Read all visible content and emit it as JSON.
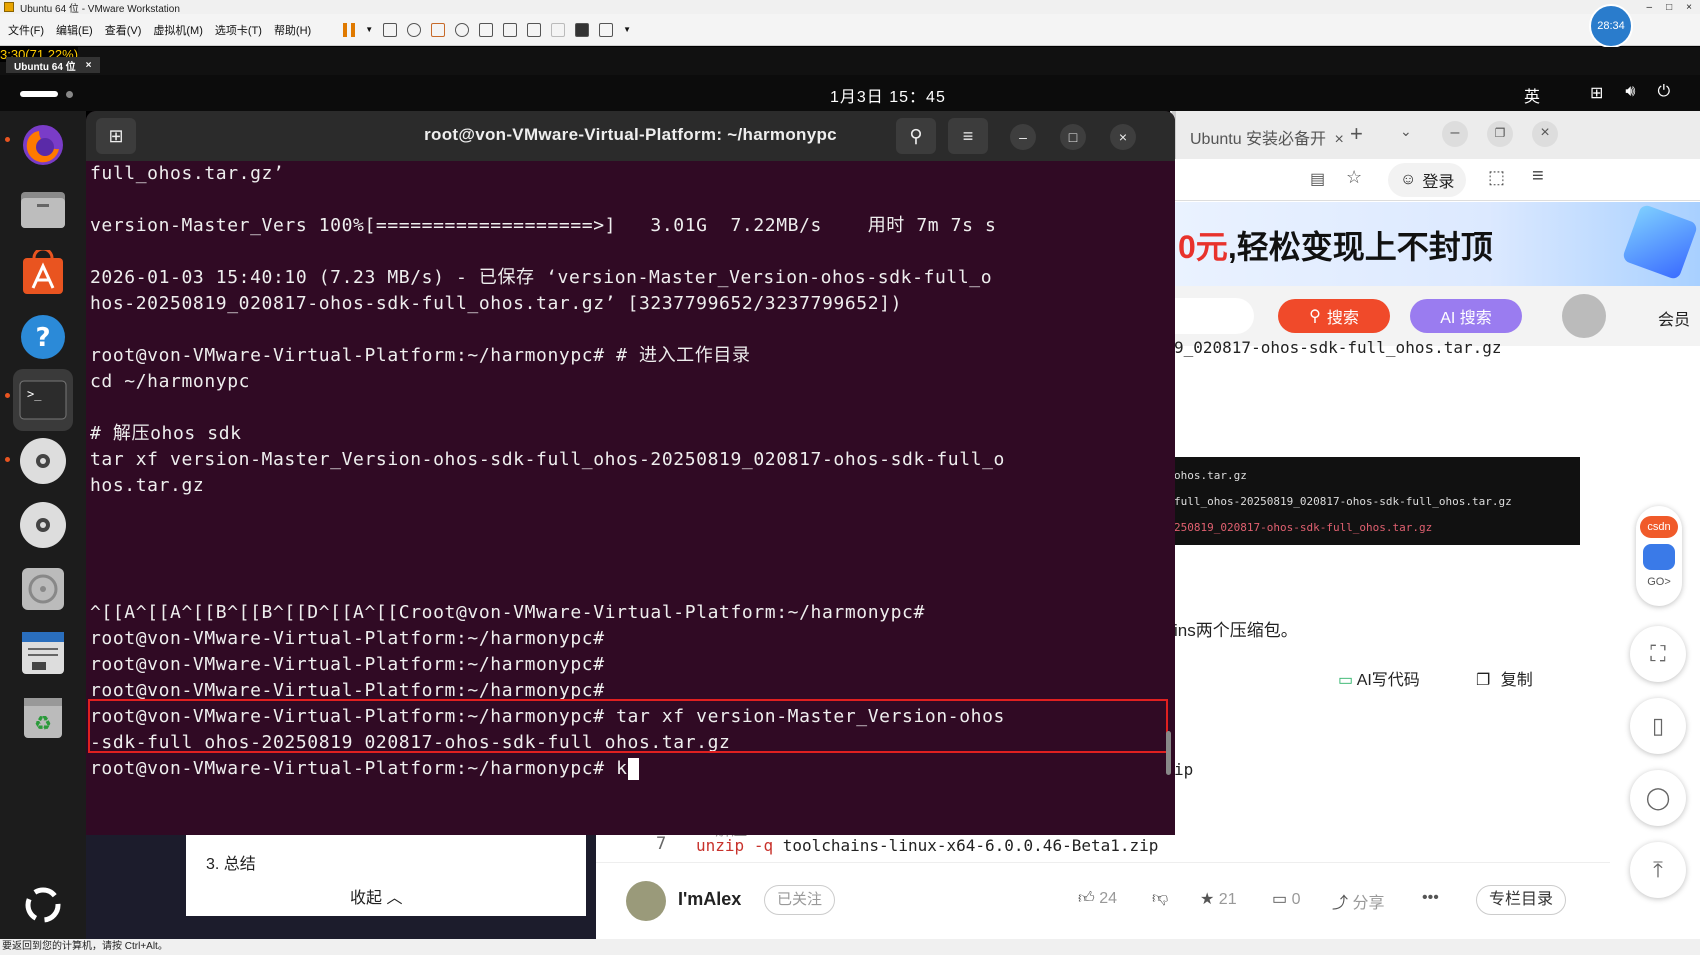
{
  "vmware": {
    "title": "Ubuntu 64 位 - VMware Workstation",
    "menu": [
      "文件(F)",
      "编辑(E)",
      "查看(V)",
      "虚拟机(M)",
      "选项卡(T)",
      "帮助(H)"
    ],
    "clock": "28:34",
    "zoom_text": "3:30(71.22%)",
    "vm_tab": "Ubuntu 64 位",
    "vm_tab_close": "×",
    "status": "要返回到您的计算机，请按 Ctrl+Alt。"
  },
  "gnome": {
    "datetime": "1月3日  15：45",
    "ime": "英",
    "sys_icons": [
      "network-icon",
      "volume-icon",
      "power-icon"
    ]
  },
  "dock": {
    "items": [
      "firefox",
      "files",
      "app-center",
      "help",
      "terminal",
      "dvd-1",
      "dvd-2",
      "disk-utility",
      "text-editor",
      "trash",
      "show-apps"
    ]
  },
  "terminal": {
    "title": "root@von-VMware-Virtual-Platform: ~/harmonypc",
    "lines": [
      "full_ohos.tar.gz’",
      "",
      "version-Master_Vers 100%[===================>]   3.01G  7.22MB/s    用时 7m 7s s",
      "",
      "2026-01-03 15:40:10 (7.23 MB/s) - 已保存 ‘version-Master_Version-ohos-sdk-full_o",
      "hos-20250819_020817-ohos-sdk-full_ohos.tar.gz’ [3237799652/3237799652])",
      "",
      "root@von-VMware-Virtual-Platform:~/harmonypc# # 进入工作目录",
      "cd ~/harmonypc",
      "",
      "# 解压ohos sdk",
      "tar xf version-Master_Version-ohos-sdk-full_ohos-20250819_020817-ohos-sdk-full_o",
      "hos.tar.gz",
      "",
      "",
      "",
      "",
      "^[[A^[[A^[[B^[[B^[[D^[[A^[[Croot@von-VMware-Virtual-Platform:~/harmonypc#",
      "root@von-VMware-Virtual-Platform:~/harmonypc#",
      "root@von-VMware-Virtual-Platform:~/harmonypc#",
      "root@von-VMware-Virtual-Platform:~/harmonypc#",
      "root@von-VMware-Virtual-Platform:~/harmonypc# tar xf version-Master_Version-ohos",
      "-sdk-full_ohos-20250819_020817-ohos-sdk-full_ohos.tar.gz",
      "root@von-VMware-Virtual-Platform:~/harmonypc# k"
    ]
  },
  "browser": {
    "tab_title": "Ubuntu 安装必备开",
    "tab_close": "×",
    "new_tab": "+",
    "login": "登录",
    "banner_red": "0元",
    "banner_black": ",轻松变现上不封顶",
    "search_btn": "搜索",
    "ai_search_btn": "AI 搜索",
    "member": "会员",
    "article": {
      "path_text": "9_020817-ohos-sdk-full_ohos.tar.gz",
      "code_lines": [
        "ohos.tar.gz",
        "full_ohos-20250819_020817-ohos-sdk-full_ohos.tar.gz",
        "250819_020817-ohos-sdk-full_ohos.tar.gz"
      ],
      "zip_text": "ins两个压缩包。",
      "ai_code": "AI写代码",
      "copy": "复制",
      "ip_text": "ip",
      "line_no": "7",
      "code_cmd": "unzip",
      "code_flag": "-q",
      "code_arg": "toolchains-linux-x64-6.0.0.46-Beta1.zip",
      "hidden_comment": "# 解压toolchains"
    },
    "sidebar_card": {
      "item": "3. 总结",
      "collapse": "收起"
    },
    "author": {
      "name": "I'mAlex",
      "follow": "已关注",
      "likes": "24",
      "stars": "21",
      "comments": "0",
      "share": "分享",
      "more": "•••",
      "catalog": "专栏目录"
    },
    "csdn_badge": "csdn",
    "go": "GO>"
  }
}
